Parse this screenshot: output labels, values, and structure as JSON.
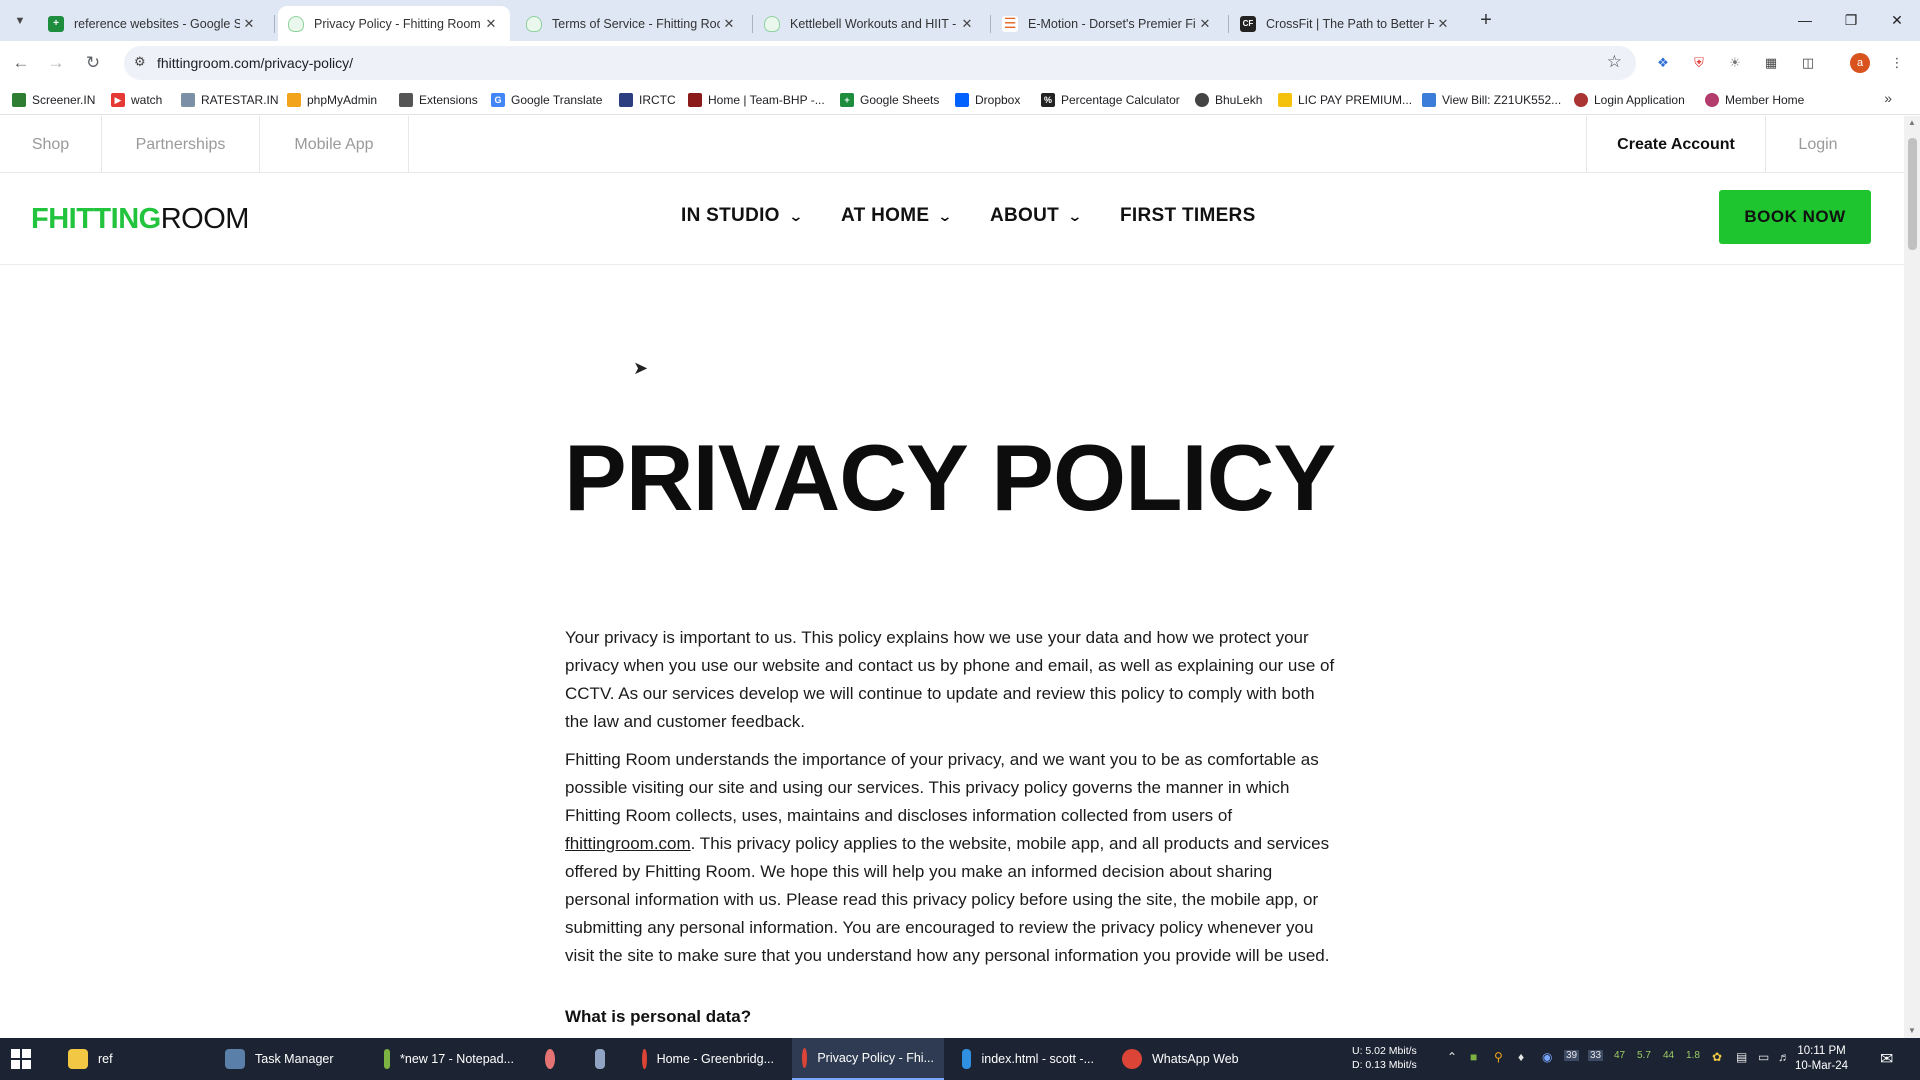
{
  "browser": {
    "tabs": [
      {
        "title": "reference websites - Google Sh",
        "icon": "google-sheets-icon",
        "color": "#1e8e3e"
      },
      {
        "title": "Privacy Policy - Fhitting Room",
        "icon": "fhitting-room-icon",
        "color": "#8fd19e",
        "active": true
      },
      {
        "title": "Terms of Service - Fhitting Roo",
        "icon": "fhitting-room-icon",
        "color": "#8fd19e"
      },
      {
        "title": "Kettlebell Workouts and HIIT -",
        "icon": "fhitting-room-icon",
        "color": "#8fd19e"
      },
      {
        "title": "E-Motion - Dorset's Premier Fit",
        "icon": "emotion-icon",
        "color": "#e8621c"
      },
      {
        "title": "CrossFit | The Path to Better He",
        "icon": "crossfit-icon",
        "color": "#222222"
      }
    ],
    "url": "fhittingroom.com/privacy-policy/",
    "bookmarks": [
      {
        "label": "Screener.IN",
        "color": "#2e7d32"
      },
      {
        "label": "watch",
        "color": "#e53935"
      },
      {
        "label": "RATESTAR.IN",
        "color": "#7b8fa6"
      },
      {
        "label": "phpMyAdmin",
        "color": "#f2a41c"
      },
      {
        "label": "Extensions",
        "color": "#555555"
      },
      {
        "label": "Google Translate",
        "color": "#4285f4"
      },
      {
        "label": "IRCTC",
        "color": "#2c3e80"
      },
      {
        "label": "Home | Team-BHP -...",
        "color": "#8b1a1a"
      },
      {
        "label": "Google Sheets",
        "color": "#1e8e3e"
      },
      {
        "label": "Dropbox",
        "color": "#0061fe"
      },
      {
        "label": "Percentage Calculator",
        "color": "#222222"
      },
      {
        "label": "BhuLekh",
        "color": "#444444"
      },
      {
        "label": "LIC PAY PREMIUM...",
        "color": "#f4c20d"
      },
      {
        "label": "View Bill: Z21UK552...",
        "color": "#3b7dd8"
      },
      {
        "label": "Login Application",
        "color": "#a33"
      },
      {
        "label": "Member Home",
        "color": "#b23c6c"
      }
    ]
  },
  "site": {
    "topnav": {
      "shop": "Shop",
      "partnerships": "Partnerships",
      "mobile_app": "Mobile App",
      "create_account": "Create Account",
      "login": "Login"
    },
    "logo_bold": "FHITTING",
    "logo_light": "ROOM",
    "mainnav": {
      "in_studio": "IN STUDIO",
      "at_home": "AT HOME",
      "about": "ABOUT",
      "first_timers": "FIRST TIMERS",
      "book_now": "BOOK NOW"
    },
    "brand_color": "#1ec52f"
  },
  "content": {
    "title": "PRIVACY POLICY",
    "p1": "Your privacy is important to us.  This policy explains how we use your data and how we protect your privacy when you use our website and contact us by phone and email, as well as explaining our use of CCTV. As our services develop we will continue to update and review this policy to comply with both the law and customer feedback.",
    "p2_before": "Fhitting Room understands the importance of your privacy, and we want you to be as comfortable as possible visiting our site and using our services. This privacy policy governs the manner in which Fhitting Room collects, uses, maintains and discloses information collected from users of",
    "p2_link": " fhittingroom.com",
    "p2_after": ". This privacy policy applies to the website, mobile app, and all products and services offered by Fhitting Room. We hope this will help you make an informed decision about sharing personal information with us. Please read this privacy policy before using the site, the mobile app, or submitting any personal information.  You are encouraged to review the privacy policy whenever you visit the site to make sure that you understand how any personal information you provide will be used.",
    "subhead": "What is personal data?"
  },
  "taskbar": {
    "items": [
      {
        "label": "ref",
        "color": "#f2c744"
      },
      {
        "label": "Task Manager",
        "color": "#5a7fa8"
      },
      {
        "label": "*new 17 - Notepad...",
        "color": "#7cb342"
      },
      {
        "label": "",
        "color": "#e57373"
      },
      {
        "label": "",
        "color": "#90a4c4"
      },
      {
        "label": "Home - Greenbridg...",
        "color": "#db4437"
      },
      {
        "label": "Privacy Policy - Fhi...",
        "color": "#db4437",
        "active": true
      },
      {
        "label": "index.html - scott -...",
        "color": "#2f8fe0"
      },
      {
        "label": "WhatsApp Web",
        "color": "#db4437"
      }
    ],
    "net_up": "U:   5.02 Mbit/s",
    "net_down": "D:   0.13 Mbit/s",
    "tray_numbers": [
      "39",
      "33",
      "47",
      "5.7",
      "44",
      "1.8"
    ],
    "time": "10:11 PM",
    "date": "10-Mar-24"
  }
}
